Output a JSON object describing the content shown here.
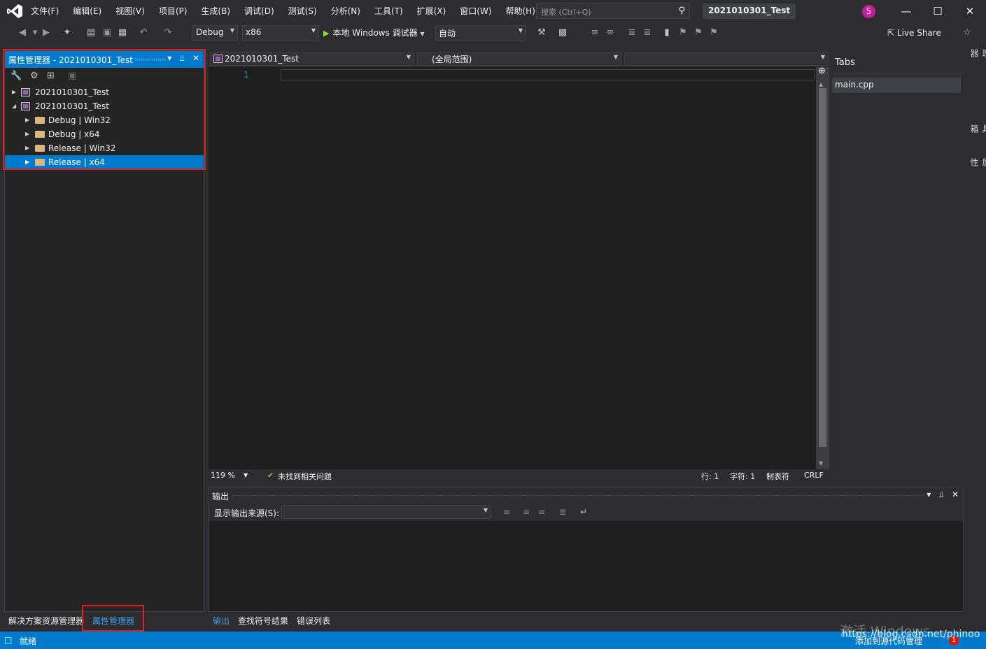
{
  "menu": [
    "文件(F)",
    "编辑(E)",
    "视图(V)",
    "项目(P)",
    "生成(B)",
    "调试(D)",
    "测试(S)",
    "分析(N)",
    "工具(T)",
    "扩展(X)",
    "窗口(W)",
    "帮助(H)"
  ],
  "search": {
    "placeholder": "搜索 (Ctrl+Q)"
  },
  "solution_name": "2021010301_Test",
  "notification_count": "5",
  "toolbar": {
    "config": "Debug",
    "platform": "x86",
    "run_label": "本地 Windows 调试器",
    "auto": "自动",
    "live_share": "Live Share"
  },
  "property_manager": {
    "title": "属性管理器 - 2021010301_Test",
    "tree": [
      {
        "label": "2021010301_Test",
        "type": "project",
        "expanded": false
      },
      {
        "label": "2021010301_Test",
        "type": "project",
        "expanded": true
      },
      {
        "label": "Debug | Win32",
        "type": "folder"
      },
      {
        "label": "Debug | x64",
        "type": "folder"
      },
      {
        "label": "Release | Win32",
        "type": "folder"
      },
      {
        "label": "Release | x64",
        "type": "folder",
        "selected": true
      }
    ]
  },
  "left_tabs": {
    "solution_explorer": "解决方案资源管理器",
    "property_manager": "属性管理器"
  },
  "editor": {
    "project_combo": "2021010301_Test",
    "scope_combo": "(全局范围)",
    "line_number": "1",
    "zoom": "119 %",
    "issues": "未找到相关问题",
    "line": "行: 1",
    "char": "字符: 1",
    "tabs": "制表符",
    "eol": "CRLF"
  },
  "tabs_panel": {
    "title": "Tabs",
    "items": [
      "main.cpp"
    ]
  },
  "side_rail": [
    "服务器资源管理器",
    "工具箱",
    "属性"
  ],
  "output": {
    "title": "输出",
    "source_label": "显示输出来源(S):"
  },
  "bottom_tabs": [
    "输出",
    "查找符号结果",
    "错误列表"
  ],
  "status": {
    "ready": "就绪",
    "source_control": "添加到源代码管理",
    "badge": "1"
  },
  "watermark": {
    "line1": "激活 Windows",
    "url": "https://blog.csdn.net/phinoo"
  },
  "colors": {
    "accent": "#007acc",
    "background": "#2d2d30",
    "editor_bg": "#1e1e1e",
    "highlight_box": "#e02020",
    "badge": "#c61e96"
  }
}
